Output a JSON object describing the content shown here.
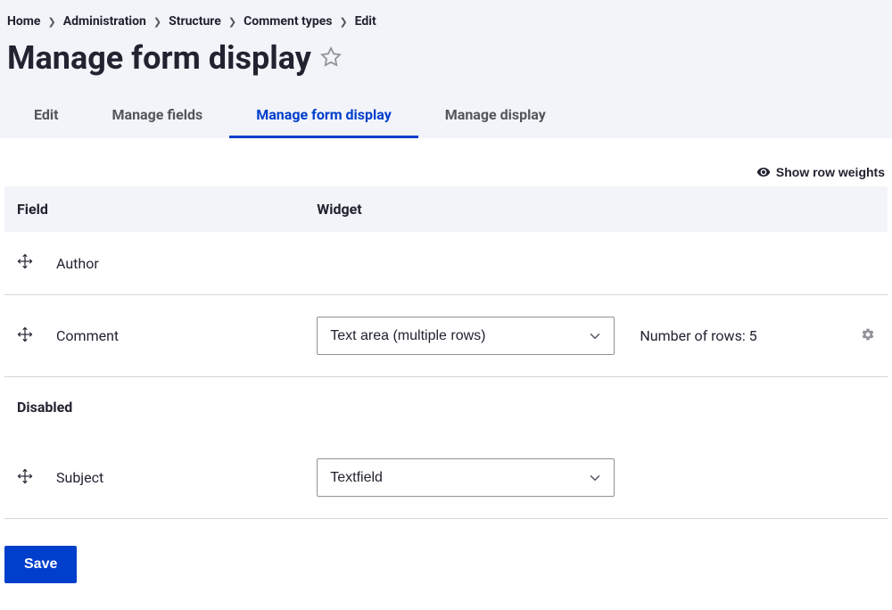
{
  "breadcrumb": {
    "items": [
      {
        "label": "Home"
      },
      {
        "label": "Administration"
      },
      {
        "label": "Structure"
      },
      {
        "label": "Comment types"
      },
      {
        "label": "Edit"
      }
    ]
  },
  "page_title": "Manage form display",
  "tabs": [
    {
      "label": "Edit",
      "active": false
    },
    {
      "label": "Manage fields",
      "active": false
    },
    {
      "label": "Manage form display",
      "active": true
    },
    {
      "label": "Manage display",
      "active": false
    }
  ],
  "weights_toggle_label": "Show row weights",
  "table": {
    "headers": {
      "field": "Field",
      "widget": "Widget"
    },
    "enabled_rows": [
      {
        "field": "Author",
        "widget": null,
        "summary": null,
        "has_settings": false
      },
      {
        "field": "Comment",
        "widget": "Text area (multiple rows)",
        "summary": "Number of rows: 5",
        "has_settings": true
      }
    ],
    "disabled_region_label": "Disabled",
    "disabled_rows": [
      {
        "field": "Subject",
        "widget": "Textfield",
        "summary": null,
        "has_settings": false
      }
    ]
  },
  "save_label": "Save"
}
